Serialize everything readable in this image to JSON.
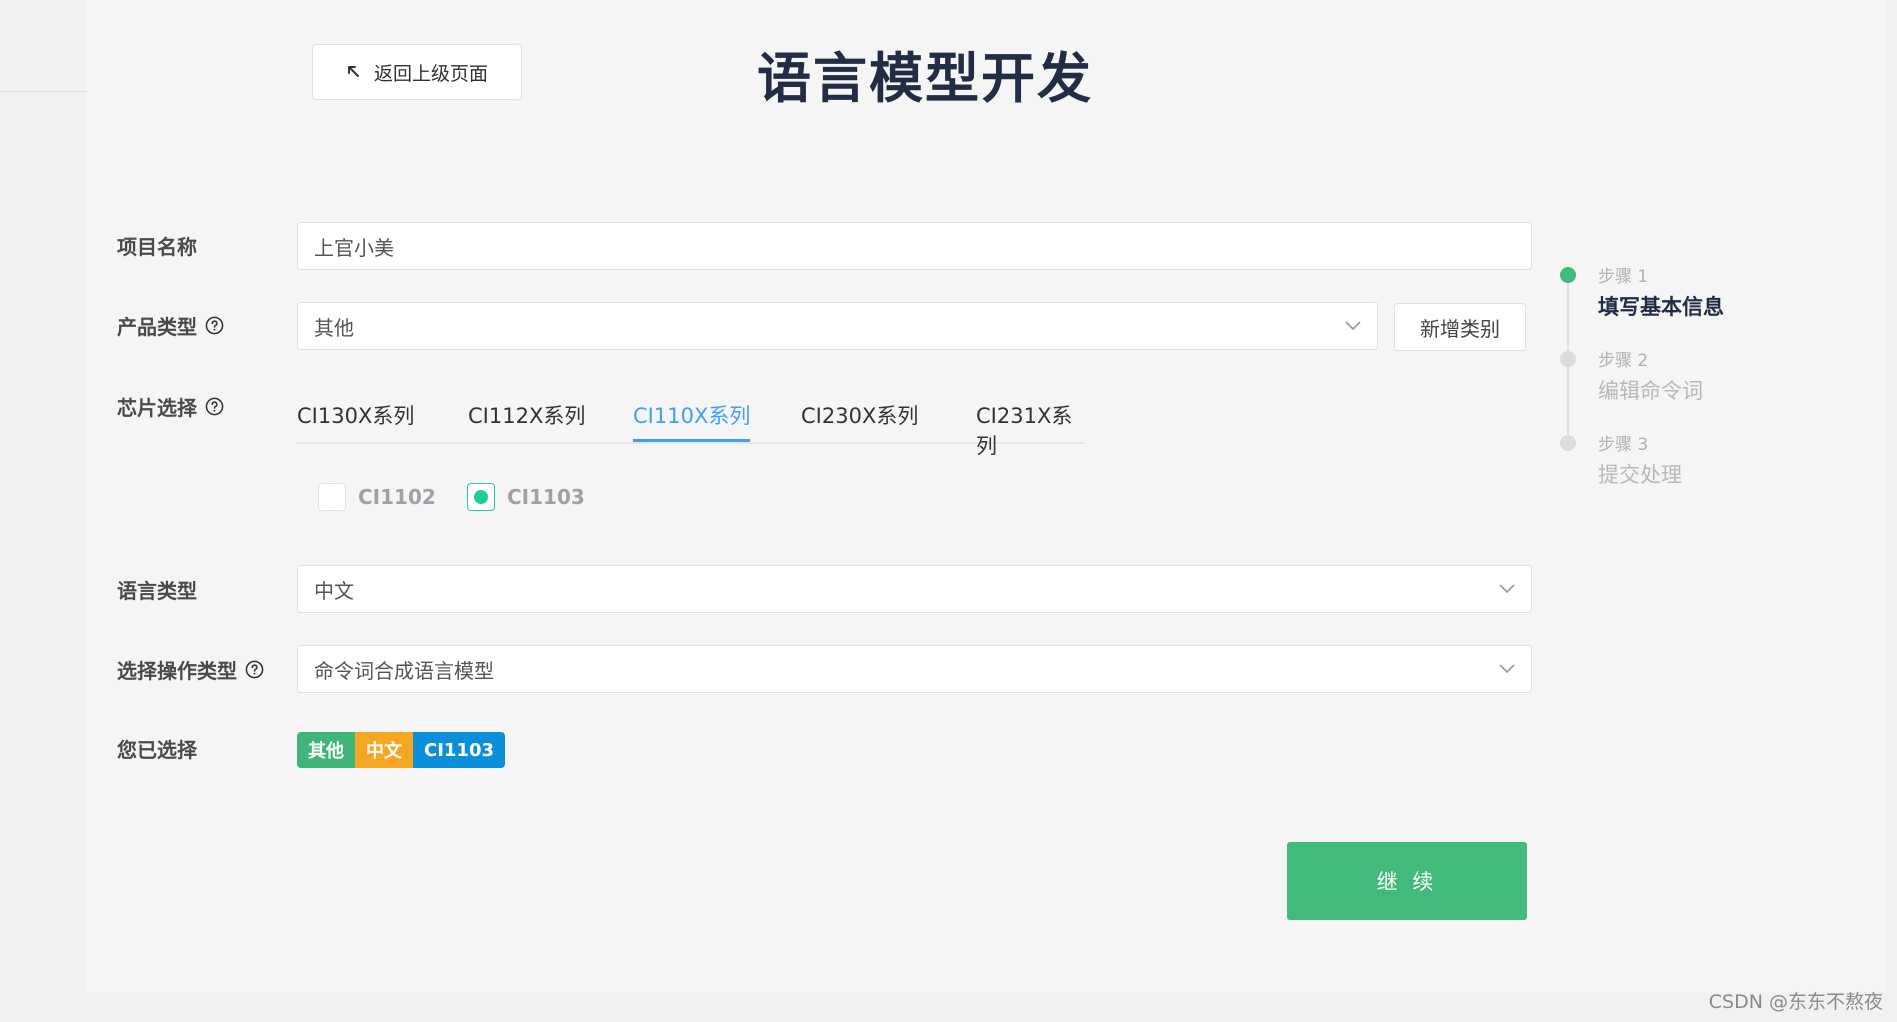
{
  "header": {
    "back_label": "返回上级页面",
    "title": "语言模型开发"
  },
  "form": {
    "project_name": {
      "label": "项目名称",
      "value": "上官小美"
    },
    "product_type": {
      "label": "产品类型",
      "value": "其他",
      "add_label": "新增类别"
    },
    "chip_select": {
      "label": "芯片选择",
      "tabs": [
        "CI130X系列",
        "CI112X系列",
        "CI110X系列",
        "CI230X系列",
        "CI231X系列"
      ],
      "active_tab": "CI110X系列",
      "options": [
        {
          "label": "CI1102",
          "checked": false
        },
        {
          "label": "CI1103",
          "checked": true
        }
      ]
    },
    "language_type": {
      "label": "语言类型",
      "value": "中文"
    },
    "operation_type": {
      "label": "选择操作类型",
      "value": "命令词合成语言模型"
    },
    "selected": {
      "label": "您已选择",
      "tags": [
        {
          "text": "其他",
          "color": "#3fb57a"
        },
        {
          "text": "中文",
          "color": "#f5a623"
        },
        {
          "text": "CI1103",
          "color": "#0a90d8"
        }
      ]
    },
    "continue_label": "继 续"
  },
  "steps": [
    {
      "no": "步骤 1",
      "title": "填写基本信息",
      "active": true
    },
    {
      "no": "步骤 2",
      "title": "编辑命令词",
      "active": false
    },
    {
      "no": "步骤 3",
      "title": "提交处理",
      "active": false
    }
  ],
  "watermark": "CSDN @东东不熬夜",
  "colors": {
    "accent_green": "#41ba7c",
    "tab_active": "#409eff",
    "title": "#222c44"
  }
}
